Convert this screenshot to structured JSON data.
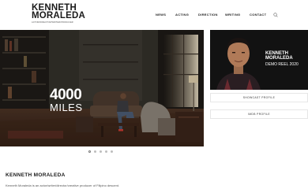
{
  "site": {
    "logo_line1": "KENNETH",
    "logo_line2": "MORALEDA",
    "tagline": "ACTOR/DIRECTOR/WRITER/PRODUCER"
  },
  "nav": {
    "items": [
      "NEWS",
      "ACTING",
      "DIRECTION",
      "WRITING",
      "CONTACT"
    ]
  },
  "icons": {
    "search": "search-icon"
  },
  "hero": {
    "title_number": "4000",
    "title_word": "MILES",
    "slide_count": 5,
    "active_slide": 1
  },
  "reel": {
    "name_line1": "KENNETH",
    "name_line2": "MORALEDA",
    "caption": "DEMO REEL 2020"
  },
  "side_buttons": {
    "showcast": "SHOWCAST PROFILE",
    "imdb": "IMDB PROFILE"
  },
  "bio": {
    "heading": "KENNETH MORALEDA",
    "text": "Kenneth Moraleda is an actor/writer/director/creative producer of Filipino descent."
  },
  "colors": {
    "accent": "#1a1a1a",
    "background": "#ffffff"
  }
}
